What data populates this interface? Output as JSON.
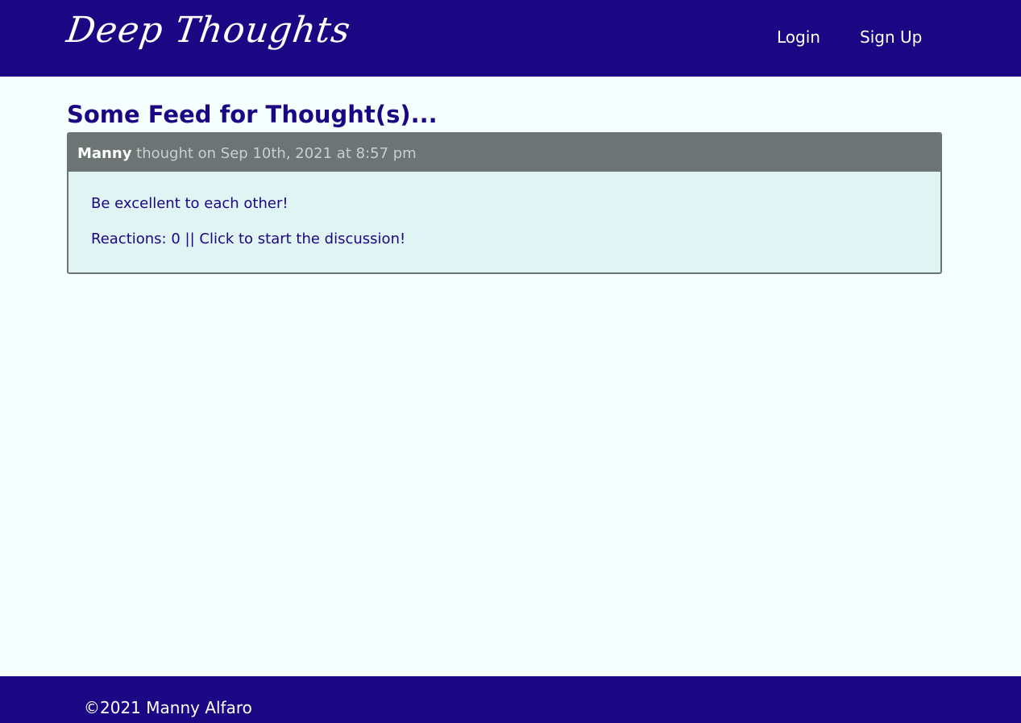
{
  "header": {
    "logo_text": "Deep Thoughts",
    "nav": {
      "login_label": "Login",
      "signup_label": "Sign Up"
    }
  },
  "main": {
    "feed_title": "Some Feed for Thought(s)...",
    "thoughts": [
      {
        "author": "Manny",
        "meta": "thought on Sep 10th, 2021 at 8:57 pm",
        "text": "Be excellent to each other!",
        "reactions_prefix": "Reactions: 0 || ",
        "discussion_link": "Click to start the discussion!"
      }
    ]
  },
  "footer": {
    "copyright": "©2021 Manny Alfaro"
  },
  "colors": {
    "brand": "#1b0683",
    "page_background": "#f5fffd",
    "card_header": "#6c7474",
    "card_body": "#e0f4f3"
  }
}
